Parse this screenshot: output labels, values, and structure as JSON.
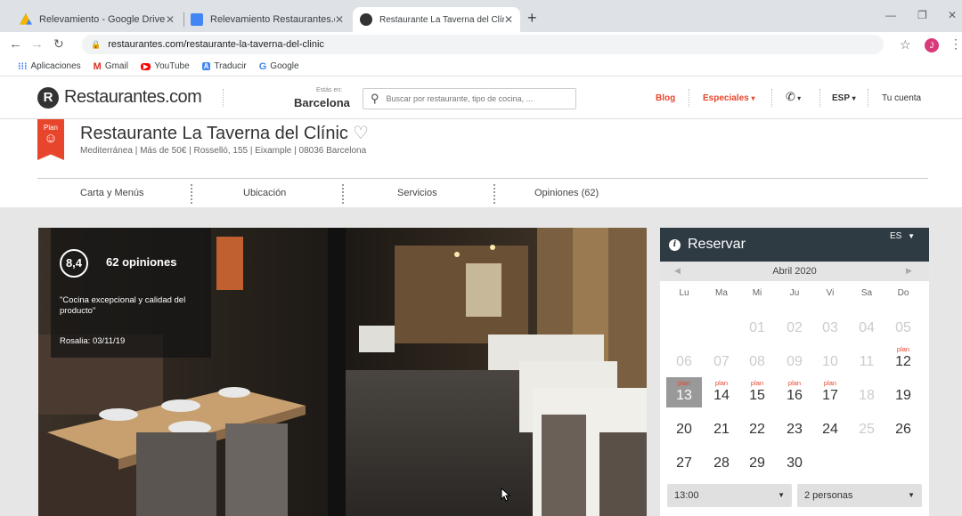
{
  "browser": {
    "tabs": [
      {
        "title": "Relevamiento - Google Drive",
        "icon": "google-drive-icon"
      },
      {
        "title": "Relevamiento Restaurantes.com",
        "icon": "google-docs-icon"
      },
      {
        "title": "Restaurante La Taverna del Clínic",
        "icon": "restaurantes-favicon"
      }
    ],
    "url": "restaurantes.com/restaurante-la-taverna-del-clinic",
    "profile_initial": "J",
    "bookmarks": [
      {
        "label": "Aplicaciones",
        "icon": "apps-icon"
      },
      {
        "label": "Gmail",
        "icon": "gmail-icon"
      },
      {
        "label": "YouTube",
        "icon": "youtube-icon"
      },
      {
        "label": "Traducir",
        "icon": "translate-icon"
      },
      {
        "label": "Google",
        "icon": "google-icon"
      }
    ]
  },
  "site": {
    "logo_letter": "R",
    "logo_text": "Restaurantes.com",
    "city_label": "Estás en:",
    "city": "Barcelona",
    "search_placeholder": "Buscar por restaurante, tipo de cocina, ...",
    "blog": "Blog",
    "especiales": "Especiales",
    "language": "ESP",
    "account": "Tu cuenta",
    "accent_color": "#e8462c"
  },
  "restaurant": {
    "badge_label": "Plan",
    "name": "Restaurante La Taverna del Clínic",
    "meta": "Mediterránea | Más de 50€ | Rosselló, 155 | Eixample | 08036 Barcelona",
    "tabs": [
      "Carta y Menús",
      "Ubicación",
      "Servicios",
      "Opiniones (62)"
    ]
  },
  "rating": {
    "score": "8,4",
    "count": "62 opiniones",
    "quote": "\"Cocina excepcional y calidad del producto\"",
    "author_date": "Rosalia: 03/11/19"
  },
  "reservation": {
    "title": "Reservar",
    "lang": "ES",
    "month": "Abril 2020",
    "weekdays": [
      "Lu",
      "Ma",
      "Mi",
      "Ju",
      "Vi",
      "Sa",
      "Do"
    ],
    "plan_label": "plan",
    "weeks": [
      [
        null,
        null,
        {
          "d": "01",
          "dim": true
        },
        {
          "d": "02",
          "dim": true
        },
        {
          "d": "03",
          "dim": true
        },
        {
          "d": "04",
          "dim": true
        },
        {
          "d": "05",
          "dim": true
        }
      ],
      [
        {
          "d": "06",
          "dim": true
        },
        {
          "d": "07",
          "dim": true
        },
        {
          "d": "08",
          "dim": true
        },
        {
          "d": "09",
          "dim": true
        },
        {
          "d": "10",
          "dim": true
        },
        {
          "d": "11",
          "dim": true
        },
        {
          "d": "12",
          "plan": true
        }
      ],
      [
        {
          "d": "13",
          "plan": true,
          "sel": true
        },
        {
          "d": "14",
          "plan": true
        },
        {
          "d": "15",
          "plan": true
        },
        {
          "d": "16",
          "plan": true
        },
        {
          "d": "17",
          "plan": true
        },
        {
          "d": "18",
          "dim": true
        },
        {
          "d": "19"
        }
      ],
      [
        {
          "d": "20"
        },
        {
          "d": "21"
        },
        {
          "d": "22"
        },
        {
          "d": "23"
        },
        {
          "d": "24"
        },
        {
          "d": "25",
          "dim": true
        },
        {
          "d": "26"
        }
      ],
      [
        {
          "d": "27"
        },
        {
          "d": "28"
        },
        {
          "d": "29"
        },
        {
          "d": "30"
        },
        null,
        null,
        null
      ]
    ],
    "time": "13:00",
    "people": "2 personas"
  }
}
